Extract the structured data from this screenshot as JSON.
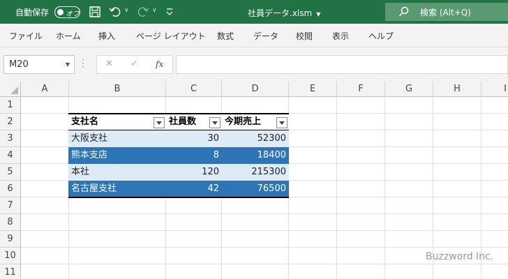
{
  "titlebar": {
    "autosave_label": "自動保存",
    "toggle_text": "オフ",
    "filename": "社員データ.xlsm",
    "search_text": "検索 (Alt+Q)"
  },
  "ribbon": {
    "tabs": [
      "ファイル",
      "ホーム",
      "挿入",
      "ページ レイアウト",
      "数式",
      "データ",
      "校閲",
      "表示",
      "ヘルプ"
    ]
  },
  "formula_bar": {
    "name_box": "M20",
    "fx_label": "fx",
    "cancel_symbol": "✕",
    "enter_symbol": "✓",
    "value": ""
  },
  "sheet": {
    "columns": [
      "A",
      "B",
      "C",
      "D",
      "E",
      "F",
      "G",
      "H",
      "I"
    ],
    "rows": [
      "1",
      "2",
      "3",
      "4",
      "5",
      "6",
      "7",
      "8",
      "9",
      "10",
      "11"
    ]
  },
  "table": {
    "headers": [
      "支社名",
      "社員数",
      "今期売上"
    ],
    "rows": [
      [
        "大阪支社",
        "30",
        "52300"
      ],
      [
        "熊本支店",
        "8",
        "18400"
      ],
      [
        "本社",
        "120",
        "215300"
      ],
      [
        "名古屋支社",
        "42",
        "76500"
      ]
    ]
  },
  "watermark": "Buzzword Inc.",
  "colors": {
    "title_bar": "#217346",
    "band_light": "#ddebf7",
    "band_dark": "#2e75b6"
  }
}
